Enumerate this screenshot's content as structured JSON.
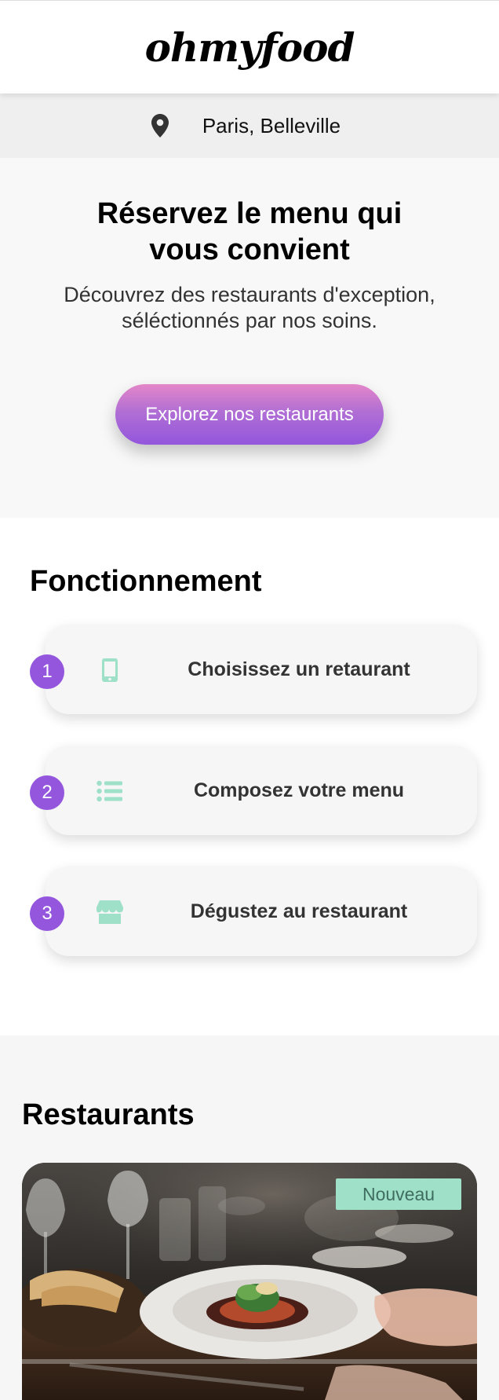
{
  "header": {
    "logo": "ohmyfood"
  },
  "location": {
    "icon": "map-pin-icon",
    "text": "Paris, Belleville"
  },
  "hero": {
    "title_line1": "Réservez le menu qui",
    "title_line2": "vous convient",
    "subtitle": "Découvrez des restaurants d'exception, séléctionnés par nos soins.",
    "cta_label": "Explorez nos restaurants"
  },
  "how": {
    "title": "Fonctionnement",
    "steps": [
      {
        "number": "1",
        "icon": "mobile-phone-icon",
        "label": "Choisissez un retaurant"
      },
      {
        "number": "2",
        "icon": "list-icon",
        "label": "Composez votre menu"
      },
      {
        "number": "3",
        "icon": "store-icon",
        "label": "Dégustez au restaurant"
      }
    ]
  },
  "restaurants": {
    "title": "Restaurants",
    "cards": [
      {
        "badge": "Nouveau",
        "image": "restaurant-dish-photo"
      }
    ]
  },
  "colors": {
    "accent_purple": "#9356dc",
    "accent_pink": "#e486c8",
    "accent_mint": "#9fe0c9"
  }
}
